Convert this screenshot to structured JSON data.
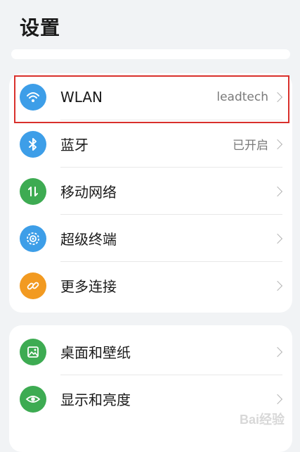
{
  "header": {
    "title": "设置"
  },
  "search": {
    "placeholder": ""
  },
  "group1": [
    {
      "label": "WLAN",
      "value": "leadtech",
      "icon": "wifi-icon",
      "color": "#3d9ee8"
    },
    {
      "label": "蓝牙",
      "value": "已开启",
      "icon": "bluetooth-icon",
      "color": "#3d9ee8"
    },
    {
      "label": "移动网络",
      "value": "",
      "icon": "mobile-data-icon",
      "color": "#3dab52"
    },
    {
      "label": "超级终端",
      "value": "",
      "icon": "super-device-icon",
      "color": "#3d9ee8"
    },
    {
      "label": "更多连接",
      "value": "",
      "icon": "link-icon",
      "color": "#f29a21"
    }
  ],
  "group2": [
    {
      "label": "桌面和壁纸",
      "value": "",
      "icon": "wallpaper-icon",
      "color": "#3dab52"
    },
    {
      "label": "显示和亮度",
      "value": "",
      "icon": "eye-icon",
      "color": "#3dab52"
    }
  ],
  "watermark": {
    "text": "Bai经验"
  }
}
